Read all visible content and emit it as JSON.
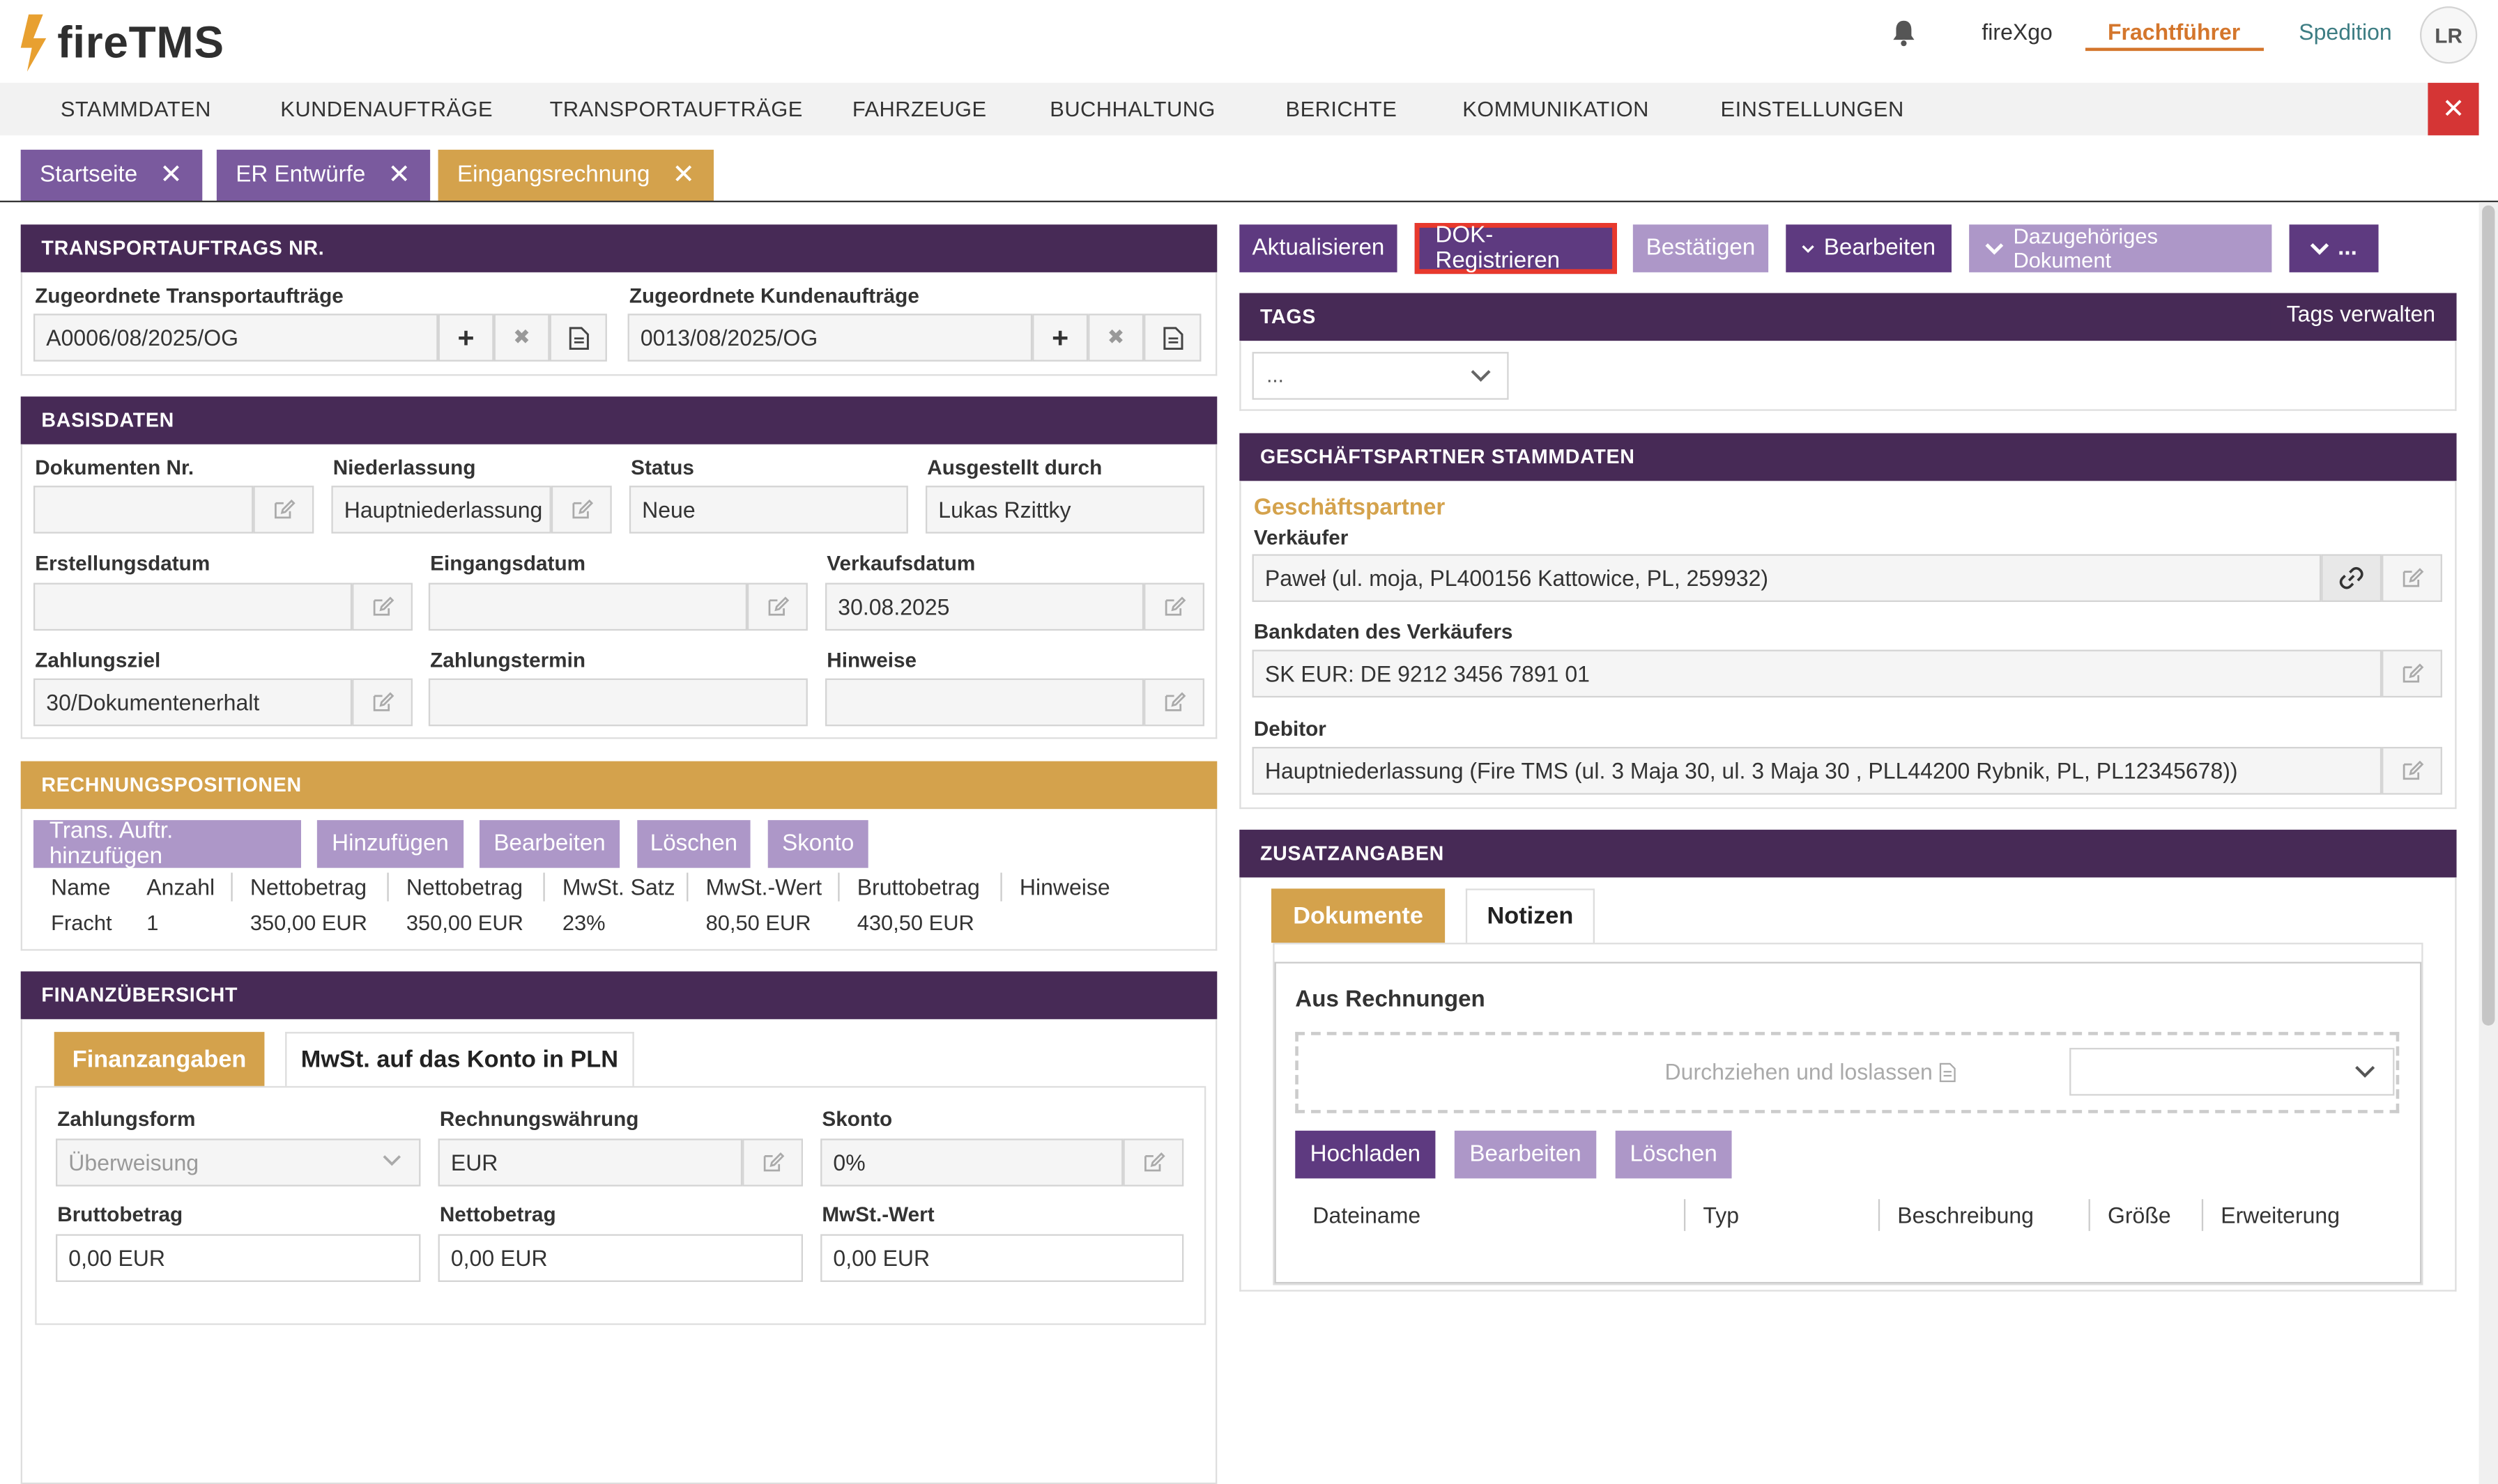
{
  "header": {
    "logo": "fireTMS",
    "links": [
      "fireXgo",
      "Frachtführer",
      "Spedition"
    ],
    "avatar": "LR"
  },
  "menu": [
    "STAMMDATEN",
    "KUNDENAUFTRÄGE",
    "TRANSPORTAUFTRÄGE",
    "FAHRZEUGE",
    "BUCHHALTUNG",
    "BERICHTE",
    "KOMMUNIKATION",
    "EINSTELLUNGEN"
  ],
  "tabs": [
    "Startseite",
    "ER Entwürfe",
    "Eingangsrechnung"
  ],
  "transport": {
    "title": "TRANSPORTAUFTRAGS NR.",
    "label_transport": "Zugeordnete Transportaufträge",
    "value_transport": "A0006/08/2025/OG",
    "label_kunden": "Zugeordnete Kundenaufträge",
    "value_kunden": "0013/08/2025/OG"
  },
  "basis": {
    "title": "BASISDATEN",
    "doc_nr_label": "Dokumenten Nr.",
    "doc_nr": "",
    "niederlassung_label": "Niederlassung",
    "niederlassung": "Hauptniederlassung",
    "status_label": "Status",
    "status": "Neue",
    "ausgestellt_label": "Ausgestellt durch",
    "ausgestellt": "Lukas Rzittky",
    "erstellung_label": "Erstellungsdatum",
    "erstellung": "",
    "eingang_label": "Eingangsdatum",
    "eingang": "",
    "verkauf_label": "Verkaufsdatum",
    "verkauf": "30.08.2025",
    "ziel_label": "Zahlungsziel",
    "ziel": "30/Dokumentenerhalt",
    "termin_label": "Zahlungstermin",
    "termin": "",
    "hinweise_label": "Hinweise",
    "hinweise": ""
  },
  "positions": {
    "title": "RECHNUNGSPOSITIONEN",
    "buttons": [
      "Trans. Auftr. hinzufügen",
      "Hinzufügen",
      "Bearbeiten",
      "Löschen",
      "Skonto"
    ],
    "columns": [
      "Name",
      "Anzahl",
      "Nettobetrag",
      "Nettobetrag",
      "MwSt. Satz",
      "MwSt.-Wert",
      "Bruttobetrag",
      "Hinweise"
    ],
    "row": [
      "Fracht",
      "1",
      "350,00 EUR",
      "350,00 EUR",
      "23%",
      "80,50 EUR",
      "430,50 EUR",
      ""
    ]
  },
  "finance": {
    "title": "FINANZÜBERSICHT",
    "tabs": [
      "Finanzangaben",
      "MwSt. auf das Konto in PLN"
    ],
    "zahlungsform_label": "Zahlungsform",
    "zahlungsform": "Überweisung",
    "waehrung_label": "Rechnungswährung",
    "waehrung": "EUR",
    "skonto_label": "Skonto",
    "skonto": "0%",
    "brutto_label": "Bruttobetrag",
    "brutto": "0,00 EUR",
    "netto_label": "Nettobetrag",
    "netto": "0,00 EUR",
    "mwst_label": "MwSt.-Wert",
    "mwst": "0,00 EUR"
  },
  "actions": [
    "Aktualisieren",
    "DOK-Registrieren",
    "Bestätigen",
    "Bearbeiten",
    "Dazugehöriges Dokument",
    "..."
  ],
  "tags": {
    "title": "TAGS",
    "manage": "Tags verwalten",
    "select": "..."
  },
  "partner": {
    "title": "GESCHÄFTSPARTNER STAMMDATEN",
    "subtitle": "Geschäftspartner",
    "seller_label": "Verkäufer",
    "seller": "Paweł (ul. moja, PL400156 Kattowice, PL, 259932)",
    "bank_label": "Bankdaten des Verkäufers",
    "bank": "SK EUR: DE 9212 3456 7891 01",
    "debitor_label": "Debitor",
    "debitor": "Hauptniederlassung (Fire TMS  (ul. 3 Maja 30, ul. 3 Maja 30 , PLL44200 Rybnik, PL, PL12345678))"
  },
  "extra": {
    "title": "ZUSATZANGABEN",
    "tabs": [
      "Dokumente",
      "Notizen"
    ],
    "section": "Aus Rechnungen",
    "dropzone": "Durchziehen und loslassen",
    "buttons": [
      "Hochladen",
      "Bearbeiten",
      "Löschen"
    ],
    "columns": [
      "Dateiname",
      "Typ",
      "Beschreibung",
      "Größe",
      "Erweiterung"
    ]
  },
  "colors": {
    "header_purple": "#472a56",
    "button_purple": "#5e3a80",
    "button_light": "#ad97c8",
    "gold": "#d4a24c",
    "close_red": "#d53535",
    "highlight_red": "#e8392d"
  }
}
